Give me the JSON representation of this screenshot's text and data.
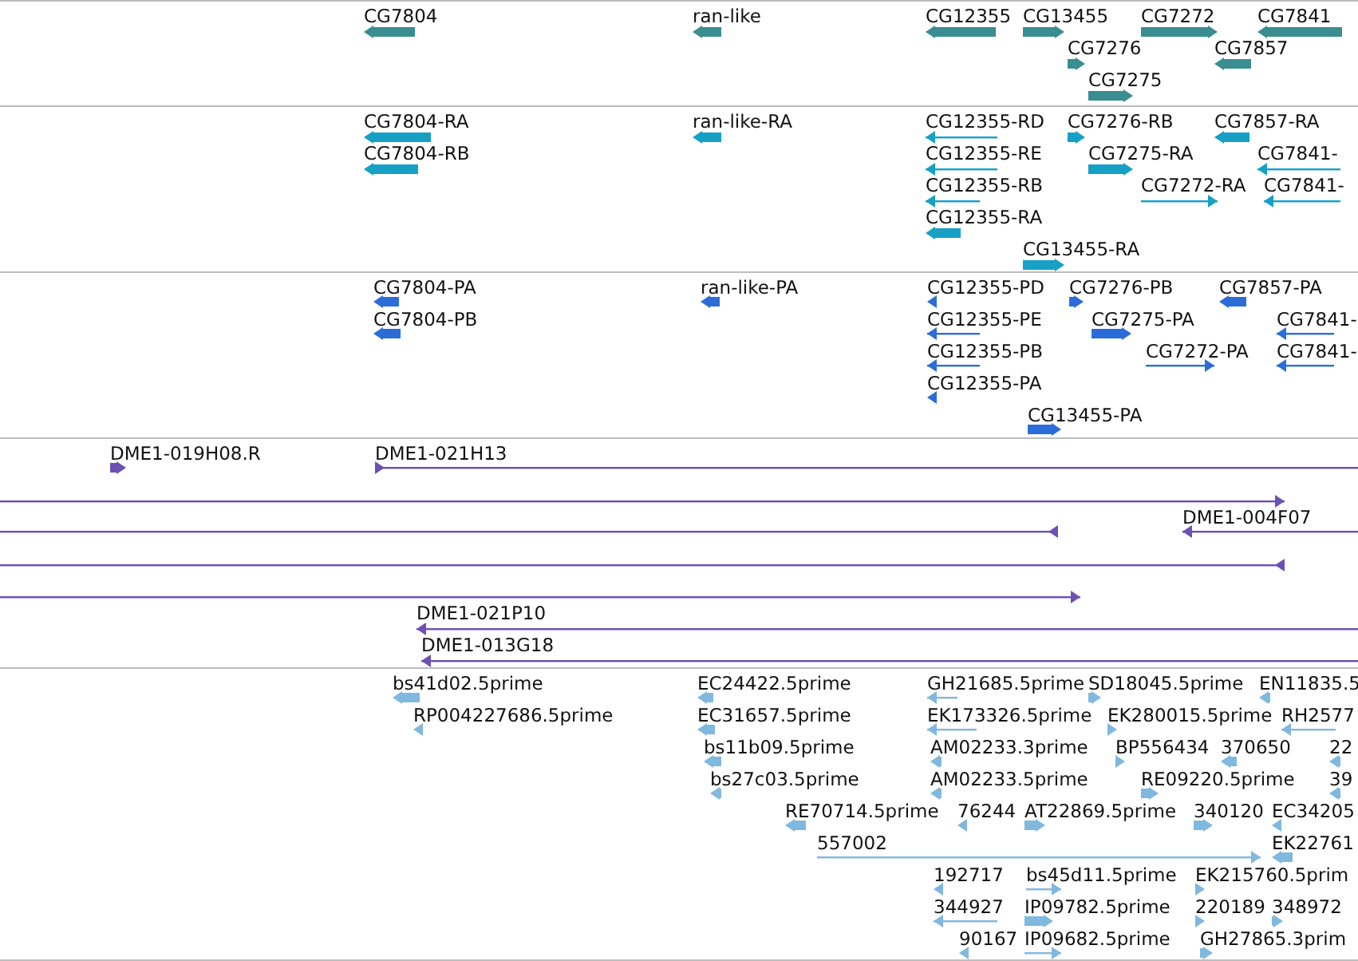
{
  "tracks": [
    {
      "kind": "gene",
      "features": [
        {
          "label": "CG7804",
          "reverse": true
        },
        {
          "label": "ran-like",
          "reverse": true
        },
        {
          "label": "CG12355",
          "reverse": true
        },
        {
          "label": "CG13455",
          "reverse": false
        },
        {
          "label": "CG7272",
          "reverse": false
        },
        {
          "label": "CG7841",
          "reverse": true
        },
        {
          "label": "CG7276",
          "reverse": false
        },
        {
          "label": "CG7857",
          "reverse": true
        },
        {
          "label": "CG7275",
          "reverse": false
        }
      ]
    },
    {
      "kind": "mrna",
      "features": [
        {
          "label": "CG7804-RA",
          "reverse": true
        },
        {
          "label": "ran-like-RA",
          "reverse": true
        },
        {
          "label": "CG12355-RD",
          "reverse": true
        },
        {
          "label": "CG7276-RB",
          "reverse": false
        },
        {
          "label": "CG7857-RA",
          "reverse": true
        },
        {
          "label": "CG7804-RB",
          "reverse": true
        },
        {
          "label": "CG12355-RE",
          "reverse": true
        },
        {
          "label": "CG7275-RA",
          "reverse": false
        },
        {
          "label": "CG7841-",
          "reverse": true
        },
        {
          "label": "CG12355-RB",
          "reverse": true
        },
        {
          "label": "CG7272-RA",
          "reverse": false
        },
        {
          "label": "CG7841-",
          "reverse": true
        },
        {
          "label": "CG12355-RA",
          "reverse": true
        },
        {
          "label": "CG13455-RA",
          "reverse": false
        }
      ]
    },
    {
      "kind": "protein",
      "features": [
        {
          "label": "CG7804-PA",
          "reverse": true
        },
        {
          "label": "ran-like-PA",
          "reverse": true
        },
        {
          "label": "CG12355-PD",
          "reverse": true
        },
        {
          "label": "CG7276-PB",
          "reverse": false
        },
        {
          "label": "CG7857-PA",
          "reverse": true
        },
        {
          "label": "CG7804-PB",
          "reverse": true
        },
        {
          "label": "CG12355-PE",
          "reverse": true
        },
        {
          "label": "CG7275-PA",
          "reverse": false
        },
        {
          "label": "CG7841-",
          "reverse": true
        },
        {
          "label": "CG12355-PB",
          "reverse": true
        },
        {
          "label": "CG7272-PA",
          "reverse": false
        },
        {
          "label": "CG7841-",
          "reverse": true
        },
        {
          "label": "CG12355-PA",
          "reverse": true
        },
        {
          "label": "CG13455-PA",
          "reverse": false
        }
      ]
    },
    {
      "kind": "clone",
      "features": [
        {
          "label": "DME1-019H08.R",
          "reverse": false
        },
        {
          "label": "DME1-021H13",
          "reverse": false
        },
        {
          "reverse": false
        },
        {
          "label": "DME1-004F07",
          "reverse": true
        },
        {
          "reverse": true
        },
        {
          "reverse": true
        },
        {
          "reverse": false
        },
        {
          "label": "DME1-021P10",
          "reverse": true
        },
        {
          "label": "DME1-013G18",
          "reverse": true
        }
      ]
    },
    {
      "kind": "est",
      "features": [
        {
          "label": "bs41d02.5prime",
          "reverse": true
        },
        {
          "label": "EC24422.5prime",
          "reverse": true
        },
        {
          "label": "GH21685.5prime",
          "reverse": true
        },
        {
          "label": "SD18045.5prime",
          "reverse": false
        },
        {
          "label": "EN11835.5",
          "reverse": true
        },
        {
          "label": "RP004227686.5prime",
          "reverse": true
        },
        {
          "label": "EC31657.5prime",
          "reverse": true
        },
        {
          "label": "EK173326.5prime",
          "reverse": true
        },
        {
          "label": "EK280015.5prime",
          "reverse": false
        },
        {
          "label": "RH2577",
          "reverse": true
        },
        {
          "label": "bs11b09.5prime",
          "reverse": true
        },
        {
          "label": "AM02233.3prime",
          "reverse": true
        },
        {
          "label": "BP556434",
          "reverse": false
        },
        {
          "label": "370650",
          "reverse": true
        },
        {
          "label": "22",
          "reverse": true
        },
        {
          "label": "bs27c03.5prime",
          "reverse": true
        },
        {
          "label": "AM02233.5prime",
          "reverse": true
        },
        {
          "label": "RE09220.5prime",
          "reverse": false
        },
        {
          "label": "39",
          "reverse": true
        },
        {
          "label": "RE70714.5prime",
          "reverse": true
        },
        {
          "label": "76244",
          "reverse": true
        },
        {
          "label": "AT22869.5prime",
          "reverse": false
        },
        {
          "label": "340120",
          "reverse": false
        },
        {
          "label": "EC34205",
          "reverse": true
        },
        {
          "label": "557002",
          "reverse": false
        },
        {
          "label": "EK22761",
          "reverse": true
        },
        {
          "label": "192717",
          "reverse": true
        },
        {
          "label": "bs45d11.5prime",
          "reverse": false
        },
        {
          "label": "EK215760.5prim",
          "reverse": false
        },
        {
          "label": "344927",
          "reverse": true
        },
        {
          "label": "IP09782.5prime",
          "reverse": false
        },
        {
          "label": "220189",
          "reverse": false
        },
        {
          "label": "348972",
          "reverse": false
        },
        {
          "label": "90167",
          "reverse": true
        },
        {
          "label": "IP09682.5prime",
          "reverse": false
        },
        {
          "label": "GH27865.3prim",
          "reverse": false
        }
      ]
    }
  ]
}
